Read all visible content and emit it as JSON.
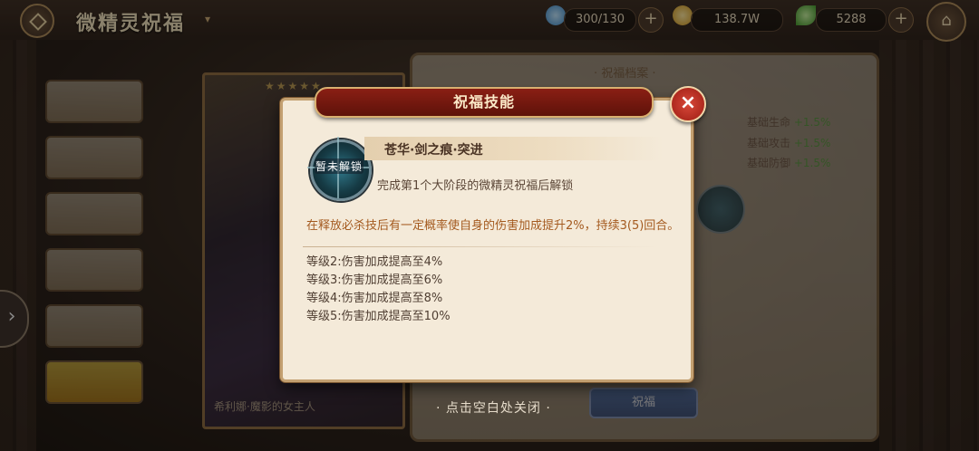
{
  "header": {
    "title": "微精灵祝福",
    "resources": [
      {
        "name": "crystal",
        "value": "300/130",
        "color": "#5fb3e8"
      },
      {
        "name": "gold",
        "value": "138.7W",
        "color": "#e8b83a"
      },
      {
        "name": "leaf",
        "value": "5288",
        "color": "#5ac23a"
      }
    ]
  },
  "card": {
    "caption": "希利娜·魔影的女主人",
    "stars": "★★★★★"
  },
  "right_panel": {
    "title": "· 祝福档案 ·",
    "stats": [
      {
        "label": "基础生命",
        "value": "+1.5%"
      },
      {
        "label": "基础攻击",
        "value": "+1.5%"
      },
      {
        "label": "基础防御",
        "value": "+1.5%"
      }
    ],
    "button_label": "祝福"
  },
  "dialog": {
    "title": "祝福技能",
    "close_label": "×",
    "skill": {
      "lock_tag": "暂未解锁",
      "name": "苍华·剑之痕·突进",
      "unlock_condition": "完成第1个大阶段的微精灵祝福后解锁",
      "description": "在释放必杀技后有一定概率使自身的伤害加成提升2%，持续3(5)回合。",
      "levels": [
        "等级2:伤害加成提高至4%",
        "等级3:伤害加成提高至6%",
        "等级4:伤害加成提高至8%",
        "等级5:伤害加成提高至10%"
      ]
    }
  },
  "close_hint": "· 点击空白处关闭 ·"
}
